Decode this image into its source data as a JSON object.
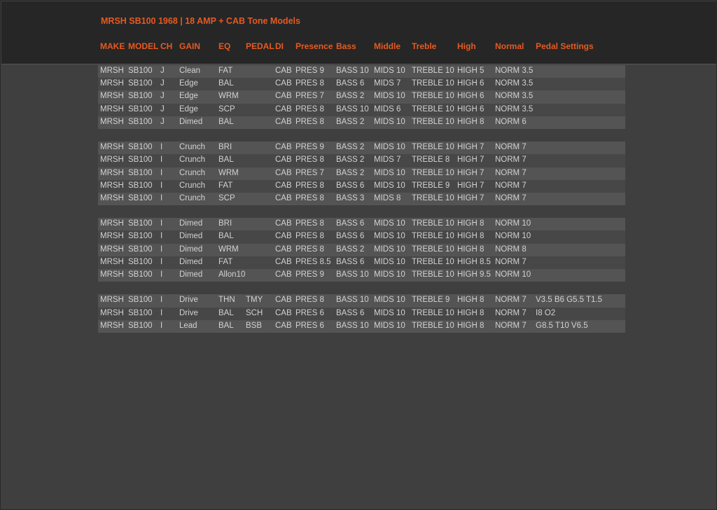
{
  "title": "MRSH SB100 1968 | 18 AMP + CAB Tone Models",
  "columns": [
    "MAKE",
    "MODEL",
    "CH",
    "GAIN",
    "EQ",
    "PEDAL",
    "DI",
    "Presence",
    "Bass",
    "Middle",
    "Treble",
    "High",
    "Normal",
    "Pedal Settings"
  ],
  "rows": [
    [
      "MRSH",
      "SB100",
      "J",
      "Clean",
      "FAT",
      "",
      "CAB",
      "PRES 9",
      "BASS 10",
      "MIDS 10",
      "TREBLE 10",
      "HIGH 5",
      "NORM 3.5",
      ""
    ],
    [
      "MRSH",
      "SB100",
      "J",
      "Edge",
      "BAL",
      "",
      "CAB",
      "PRES 8",
      "BASS 6",
      "MIDS 7",
      "TREBLE 10",
      "HIGH 6",
      "NORM 3.5",
      ""
    ],
    [
      "MRSH",
      "SB100",
      "J",
      "Edge",
      "WRM",
      "",
      "CAB",
      "PRES 7",
      "BASS 2",
      "MIDS 10",
      "TREBLE 10",
      "HIGH 6",
      "NORM 3.5",
      ""
    ],
    [
      "MRSH",
      "SB100",
      "J",
      "Edge",
      "SCP",
      "",
      "CAB",
      "PRES 8",
      "BASS 10",
      "MIDS 6",
      "TREBLE 10",
      "HIGH 6",
      "NORM 3.5",
      ""
    ],
    [
      "MRSH",
      "SB100",
      "J",
      "Dimed",
      "BAL",
      "",
      "CAB",
      "PRES 8",
      "BASS 2",
      "MIDS 10",
      "TREBLE 10",
      "HIGH 8",
      "NORM 6",
      ""
    ],
    null,
    [
      "MRSH",
      "SB100",
      "I",
      "Crunch",
      "BRI",
      "",
      "CAB",
      "PRES 9",
      "BASS 2",
      "MIDS 10",
      "TREBLE 10",
      "HIGH 7",
      "NORM 7",
      ""
    ],
    [
      "MRSH",
      "SB100",
      "I",
      "Crunch",
      "BAL",
      "",
      "CAB",
      "PRES 8",
      "BASS 2",
      "MIDS 7",
      "TREBLE 8",
      "HIGH 7",
      "NORM 7",
      ""
    ],
    [
      "MRSH",
      "SB100",
      "I",
      "Crunch",
      "WRM",
      "",
      "CAB",
      "PRES 7",
      "BASS 2",
      "MIDS 10",
      "TREBLE 10",
      "HIGH 7",
      "NORM 7",
      ""
    ],
    [
      "MRSH",
      "SB100",
      "I",
      "Crunch",
      "FAT",
      "",
      "CAB",
      "PRES 8",
      "BASS 6",
      "MIDS 10",
      "TREBLE 9",
      "HIGH 7",
      "NORM 7",
      ""
    ],
    [
      "MRSH",
      "SB100",
      "I",
      "Crunch",
      "SCP",
      "",
      "CAB",
      "PRES 8",
      "BASS 3",
      "MIDS 8",
      "TREBLE 10",
      "HIGH 7",
      "NORM 7",
      ""
    ],
    null,
    [
      "MRSH",
      "SB100",
      "I",
      "Dimed",
      "BRI",
      "",
      "CAB",
      "PRES 8",
      "BASS 6",
      "MIDS 10",
      "TREBLE 10",
      "HIGH 8",
      "NORM 10",
      ""
    ],
    [
      "MRSH",
      "SB100",
      "I",
      "Dimed",
      "BAL",
      "",
      "CAB",
      "PRES 8",
      "BASS 6",
      "MIDS 10",
      "TREBLE 10",
      "HIGH 8",
      "NORM 10",
      ""
    ],
    [
      "MRSH",
      "SB100",
      "I",
      "Dimed",
      "WRM",
      "",
      "CAB",
      "PRES 8",
      "BASS 2",
      "MIDS 10",
      "TREBLE 10",
      "HIGH 8",
      "NORM 8",
      ""
    ],
    [
      "MRSH",
      "SB100",
      "I",
      "Dimed",
      "FAT",
      "",
      "CAB",
      "PRES 8.5",
      "BASS 6",
      "MIDS 10",
      "TREBLE 10",
      "HIGH 8.5",
      "NORM 7",
      ""
    ],
    [
      "MRSH",
      "SB100",
      "I",
      "Dimed",
      "Allon10",
      "",
      "CAB",
      "PRES 9",
      "BASS 10",
      "MIDS 10",
      "TREBLE 10",
      "HIGH 9.5",
      "NORM 10",
      ""
    ],
    null,
    [
      "MRSH",
      "SB100",
      "I",
      "Drive",
      "THN",
      "TMY",
      "CAB",
      "PRES 8",
      "BASS 10",
      "MIDS 10",
      "TREBLE 9",
      "HIGH 8",
      "NORM 7",
      "V3.5 B6 G5.5 T1.5"
    ],
    [
      "MRSH",
      "SB100",
      "I",
      "Drive",
      "BAL",
      "SCH",
      "CAB",
      "PRES 6",
      "BASS 6",
      "MIDS 10",
      "TREBLE 10",
      "HIGH 8",
      "NORM 7",
      "I8 O2"
    ],
    [
      "MRSH",
      "SB100",
      "I",
      "Lead",
      "BAL",
      "BSB",
      "CAB",
      "PRES 6",
      "BASS 10",
      "MIDS 10",
      "TREBLE 10",
      "HIGH 8",
      "NORM 7",
      "G8.5 T10 V6.5"
    ]
  ]
}
